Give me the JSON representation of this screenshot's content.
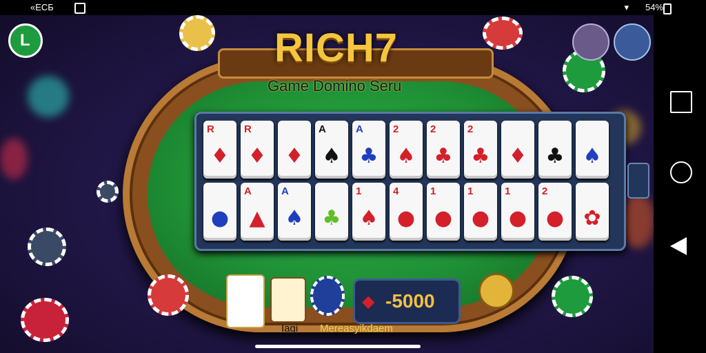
{
  "status_bar": {
    "left_text": "«ЕСБ",
    "battery_text": "54%"
  },
  "logo": {
    "title": "RICH7",
    "subtitle": "Game Domino Seru"
  },
  "board": {
    "top_row": [
      {
        "rank": "R",
        "suit": "♦",
        "color": "#d3202a"
      },
      {
        "rank": "R",
        "suit": "♦",
        "color": "#d3202a"
      },
      {
        "rank": "",
        "suit": "♦",
        "color": "#d3202a"
      },
      {
        "rank": "A",
        "suit": "♠",
        "color": "#111111"
      },
      {
        "rank": "A",
        "suit": "♣",
        "color": "#1f3fbf"
      },
      {
        "rank": "2",
        "suit": "♠",
        "color": "#d3202a"
      },
      {
        "rank": "2",
        "suit": "♣",
        "color": "#d3202a"
      },
      {
        "rank": "2",
        "suit": "♣",
        "color": "#d3202a"
      },
      {
        "rank": "",
        "suit": "♦",
        "color": "#d3202a"
      },
      {
        "rank": "",
        "suit": "♣",
        "color": "#111111"
      },
      {
        "rank": "",
        "suit": "♠",
        "color": "#1f3fbf"
      }
    ],
    "bottom_row": [
      {
        "rank": "",
        "suit": "●",
        "color": "#1f3fbf"
      },
      {
        "rank": "A",
        "suit": "▲",
        "color": "#d3202a"
      },
      {
        "rank": "A",
        "suit": "♠",
        "color": "#1f3fbf"
      },
      {
        "rank": "",
        "suit": "♣",
        "color": "#5fbf2a"
      },
      {
        "rank": "1",
        "suit": "♠",
        "color": "#d3202a"
      },
      {
        "rank": "4",
        "suit": "●",
        "color": "#d3202a"
      },
      {
        "rank": "1",
        "suit": "●",
        "color": "#d3202a"
      },
      {
        "rank": "1",
        "suit": "●",
        "color": "#d3202a"
      },
      {
        "rank": "1",
        "suit": "●",
        "color": "#d3202a"
      },
      {
        "rank": "2",
        "suit": "●",
        "color": "#d3202a"
      },
      {
        "rank": "",
        "suit": "✿",
        "color": "#d3202a"
      }
    ]
  },
  "bottom": {
    "amount": "-5000",
    "label_left": "Iagi",
    "label_right": "Mereasyikdaem"
  },
  "colors": {
    "accent_gold": "#f5c540",
    "felt": "#1f8f35",
    "board": "#23365a"
  }
}
